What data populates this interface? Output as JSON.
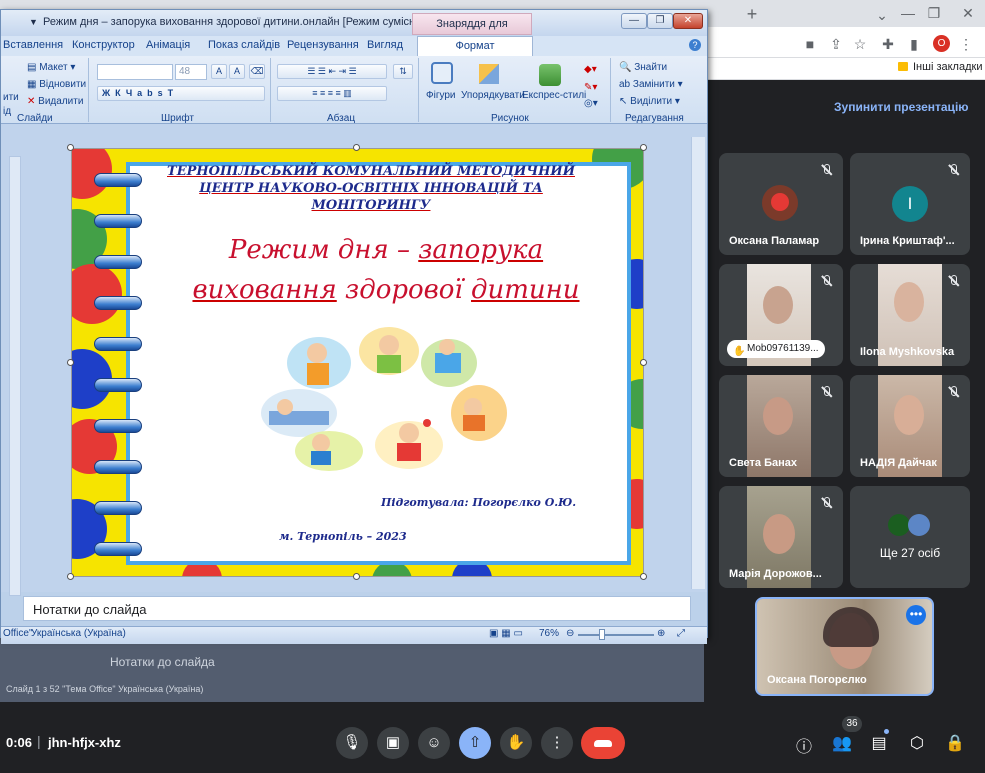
{
  "browser": {
    "new_tab": "+",
    "bookmarks": {
      "other": "Інші закладки"
    },
    "profile_initial": "О"
  },
  "meet": {
    "stop_presenting": "Зупинити презентацію",
    "participants": [
      {
        "name": "Оксана Паламар",
        "color": "#5f3b2c"
      },
      {
        "name": "Ірина Криштаф'...",
        "initial": "І",
        "color": "#12858f"
      },
      {
        "name": "Mob09761139...",
        "color": "#d9cfc6"
      },
      {
        "name": "Ilona Myshkovska",
        "color": "#c9b6a7"
      },
      {
        "name": "Света Банах",
        "color": "#8e7769"
      },
      {
        "name": "НАДІЯ Дайчак",
        "color": "#a98b78"
      },
      {
        "name": "Марія Дорожов...",
        "color": "#8d8170"
      }
    ],
    "more_people": "Ще 27 осіб",
    "self_name": "Оксана Погорєлко",
    "time": "0:06",
    "separator": "|",
    "meeting_code": "jhn-hfjx-xhz",
    "participants_count": "36"
  },
  "ppt": {
    "title": "Режим дня – запорука виховання здорової дитини.онлайн [Режим сумісності] - M...",
    "contextual_tab": "Знаряддя для зображення",
    "tabs": [
      "Вставлення",
      "Конструктор",
      "Анімація",
      "Показ слайдів",
      "Рецензування",
      "Вигляд"
    ],
    "format_tab": "Формат",
    "ribbon": {
      "slides_group": "Слайди",
      "layout": "Макет",
      "reset": "Відновити",
      "delete": "Видалити",
      "left_cut1": "ити",
      "left_cut2": "ід",
      "font_group": "Шрифт",
      "font_size": "48",
      "paragraph_group": "Абзац",
      "drawing_group": "Рисунок",
      "shapes": "Фігури",
      "arrange": "Упорядкувати",
      "quick_styles": "Експрес-стилі",
      "editing_group": "Редагування",
      "find": "Знайти",
      "replace": "Замінити",
      "select": "Виділити"
    },
    "slide": {
      "org_header": "ТЕРНОПІЛЬСЬКИЙ КОМУНАЛЬНИЙ МЕТОДИЧНИЙ ЦЕНТР НАУКОВО-ОСВІТНІХ ІННОВАЦІЙ ТА МОНІТОРИНГУ",
      "title_line1_a": "Режим дня – ",
      "title_line1_b": "запорука",
      "title_line2_a": "виховання",
      "title_line2_b": " здорової ",
      "title_line2_c": "дитини",
      "prepared_by": "Підготувала:  Погорєлко О.Ю.",
      "city_year": "м. Тернопіль – 2023"
    },
    "notes_placeholder": "Нотатки до слайда",
    "status": {
      "theme": "Office\"",
      "language": "Українська (Україна)",
      "zoom": "76%"
    },
    "ghost": {
      "notes": "Нотатки до слайда",
      "status": "Слайд 1 з 52    \"Тема Office\"    Українська (Україна)"
    }
  }
}
